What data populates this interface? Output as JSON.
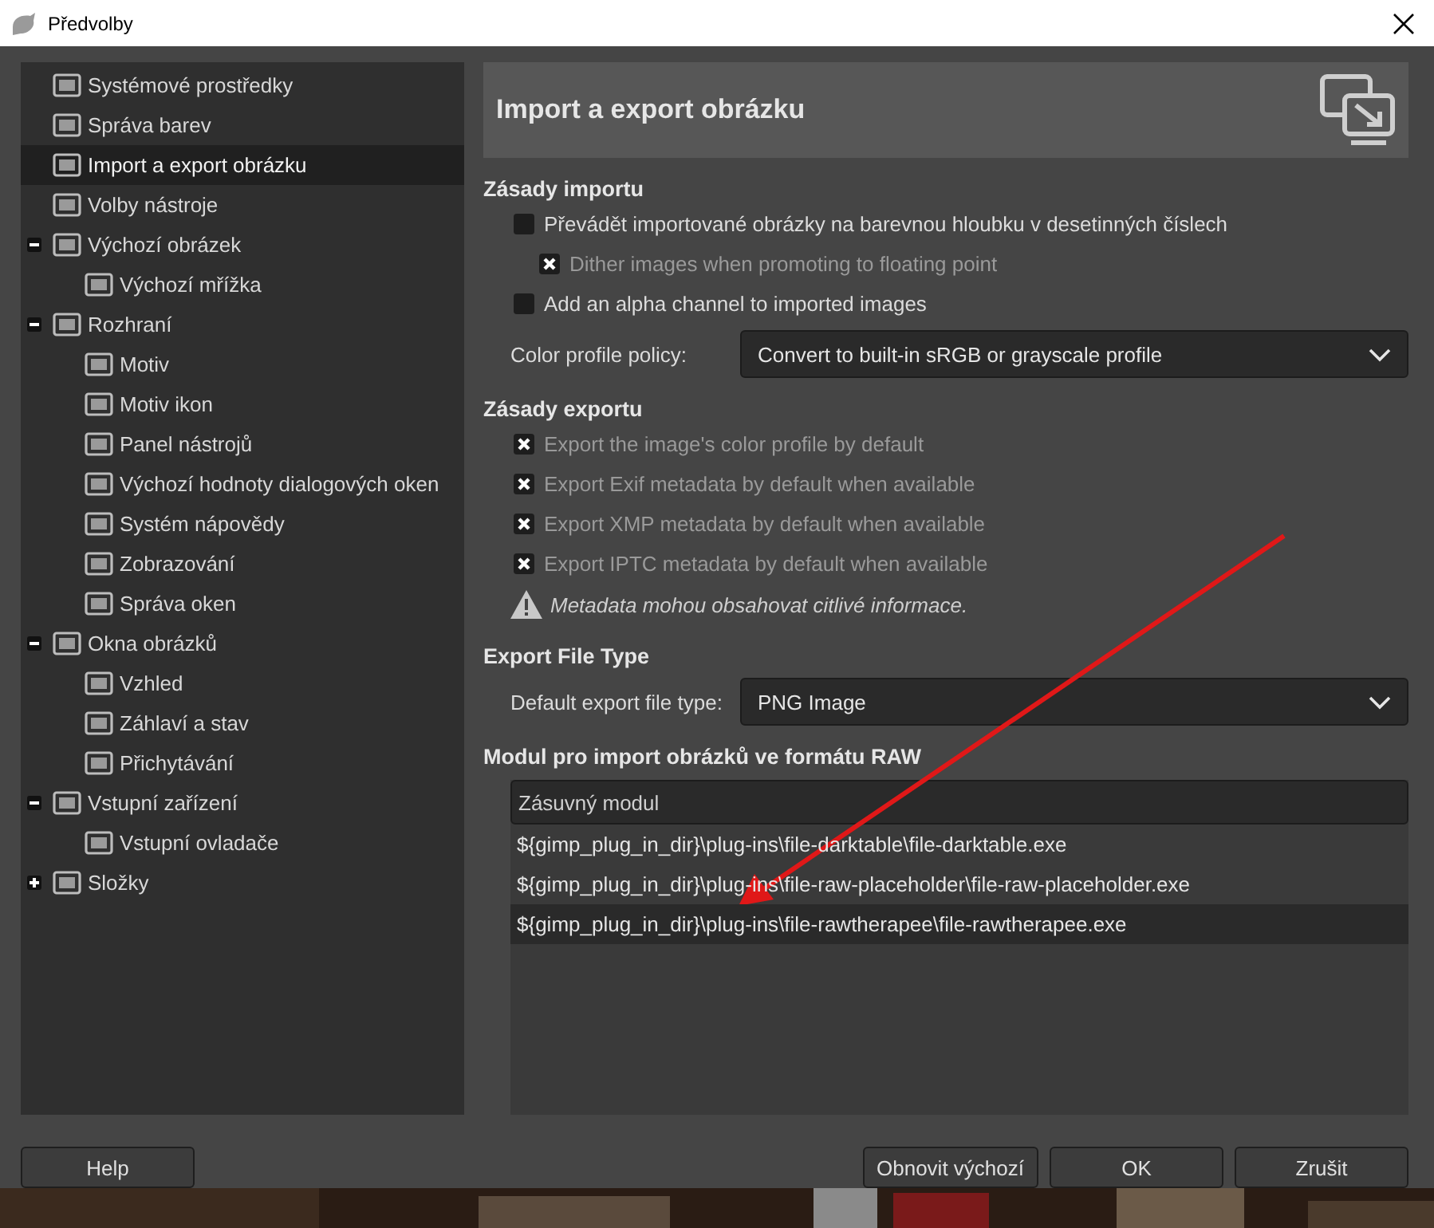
{
  "window": {
    "title": "Předvolby"
  },
  "sidebar": {
    "items": [
      {
        "label": "Systémové prostředky",
        "selected": false
      },
      {
        "label": "Správa barev",
        "selected": false
      },
      {
        "label": "Import a export obrázku",
        "selected": true
      },
      {
        "label": "Volby nástroje",
        "selected": false
      },
      {
        "label": "Výchozí obrázek",
        "selected": false,
        "expanded": true,
        "children": [
          {
            "label": "Výchozí mřížka",
            "selected": false
          }
        ]
      },
      {
        "label": "Rozhraní",
        "selected": false,
        "expanded": true,
        "children": [
          {
            "label": "Motiv",
            "selected": false
          },
          {
            "label": "Motiv ikon",
            "selected": false
          },
          {
            "label": "Panel nástrojů",
            "selected": false
          },
          {
            "label": "Výchozí hodnoty dialogových oken",
            "selected": false
          },
          {
            "label": "Systém nápovědy",
            "selected": false
          },
          {
            "label": "Zobrazování",
            "selected": false
          },
          {
            "label": "Správa oken",
            "selected": false
          }
        ]
      },
      {
        "label": "Okna obrázků",
        "selected": false,
        "expanded": true,
        "children": [
          {
            "label": "Vzhled",
            "selected": false
          },
          {
            "label": "Záhlaví a stav",
            "selected": false
          },
          {
            "label": "Přichytávání",
            "selected": false
          }
        ]
      },
      {
        "label": "Vstupní zařízení",
        "selected": false,
        "expanded": true,
        "children": [
          {
            "label": "Vstupní ovladače",
            "selected": false
          }
        ]
      },
      {
        "label": "Složky",
        "selected": false,
        "expanded": false
      }
    ]
  },
  "panel": {
    "title": "Import a export obrázku",
    "sections": [
      {
        "heading": "Zásady importu",
        "options": [
          {
            "label": "Převádět importované obrázky na barevnou hloubku v desetinných číslech",
            "checked": false,
            "disabled": false,
            "children": [
              {
                "label": "Dither images when promoting to floating point",
                "checked": true,
                "disabled": true
              }
            ]
          },
          {
            "label": "Add an alpha channel to imported images",
            "checked": false,
            "disabled": false
          }
        ],
        "dropdown": {
          "label": "Color profile policy:",
          "value": "Convert to built-in sRGB or grayscale profile"
        }
      },
      {
        "heading": "Zásady exportu",
        "options": [
          {
            "label": "Export the image's color profile by default",
            "checked": true,
            "disabled": true
          },
          {
            "label": "Export Exif metadata by default when available",
            "checked": true,
            "disabled": true
          },
          {
            "label": "Export XMP metadata by default when available",
            "checked": true,
            "disabled": true
          },
          {
            "label": "Export IPTC metadata by default when available",
            "checked": true,
            "disabled": true
          }
        ],
        "warning": "Metadata mohou obsahovat citlivé informace."
      },
      {
        "heading": "Export File Type",
        "dropdown": {
          "label": "Default export file type:",
          "value": "PNG Image"
        }
      },
      {
        "heading": "Modul pro import obrázků ve formátu RAW",
        "table": {
          "columns": [
            "Zásuvný modul"
          ],
          "rows": [
            {
              "cells": [
                "${gimp_plug_in_dir}\\plug-ins\\file-darktable\\file-darktable.exe"
              ],
              "selected": false
            },
            {
              "cells": [
                "${gimp_plug_in_dir}\\plug-ins\\file-raw-placeholder\\file-raw-placeholder.exe"
              ],
              "selected": false
            },
            {
              "cells": [
                "${gimp_plug_in_dir}\\plug-ins\\file-rawtherapee\\file-rawtherapee.exe"
              ],
              "selected": true
            }
          ]
        }
      }
    ]
  },
  "buttons": {
    "left": [
      "Help"
    ],
    "right": [
      "Obnovit výchozí",
      "OK",
      "Zrušit"
    ]
  }
}
